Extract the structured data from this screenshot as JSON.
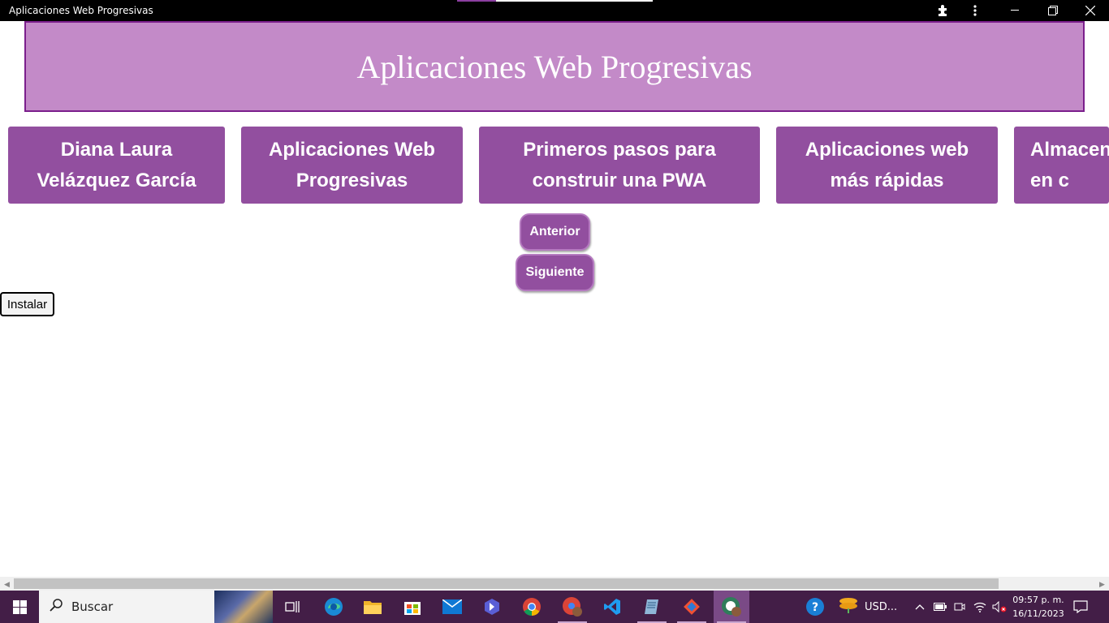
{
  "window": {
    "title": "Aplicaciones Web Progresivas"
  },
  "header": {
    "title": "Aplicaciones Web Progresivas"
  },
  "cards": [
    {
      "label": "Diana Laura Velázquez García"
    },
    {
      "label": "Aplicaciones Web Progresivas"
    },
    {
      "label": "Primeros pasos para construir una PWA"
    },
    {
      "label": "Aplicaciones web más rápidas"
    },
    {
      "label": "Almacen en c"
    }
  ],
  "nav": {
    "prev_label": "Anterior",
    "next_label": "Siguiente"
  },
  "install_label": "Instalar",
  "taskbar": {
    "search_placeholder": "Buscar",
    "tray_text": "USD...",
    "time": "09:57 p. m.",
    "date": "16/11/2023"
  },
  "colors": {
    "header_bg": "#c38ac8",
    "header_border": "#7b1f8c",
    "card_bg": "#924f9f",
    "taskbar_bg": "#431e47"
  },
  "icons": [
    "extensions-icon",
    "more-menu-icon",
    "minimize-icon",
    "restore-icon",
    "close-icon",
    "windows-start-icon",
    "search-icon",
    "task-view-icon",
    "edge-icon",
    "file-explorer-icon",
    "store-icon",
    "mail-icon",
    "power-automate-icon",
    "chrome-icon",
    "chrome-profile-icon",
    "vscode-icon",
    "notepad-icon",
    "git-icon",
    "pwa-app-icon",
    "help-icon",
    "currency-icon",
    "chevron-up-icon",
    "battery-icon",
    "meet-icon",
    "wifi-icon",
    "volume-muted-icon",
    "notifications-icon"
  ]
}
